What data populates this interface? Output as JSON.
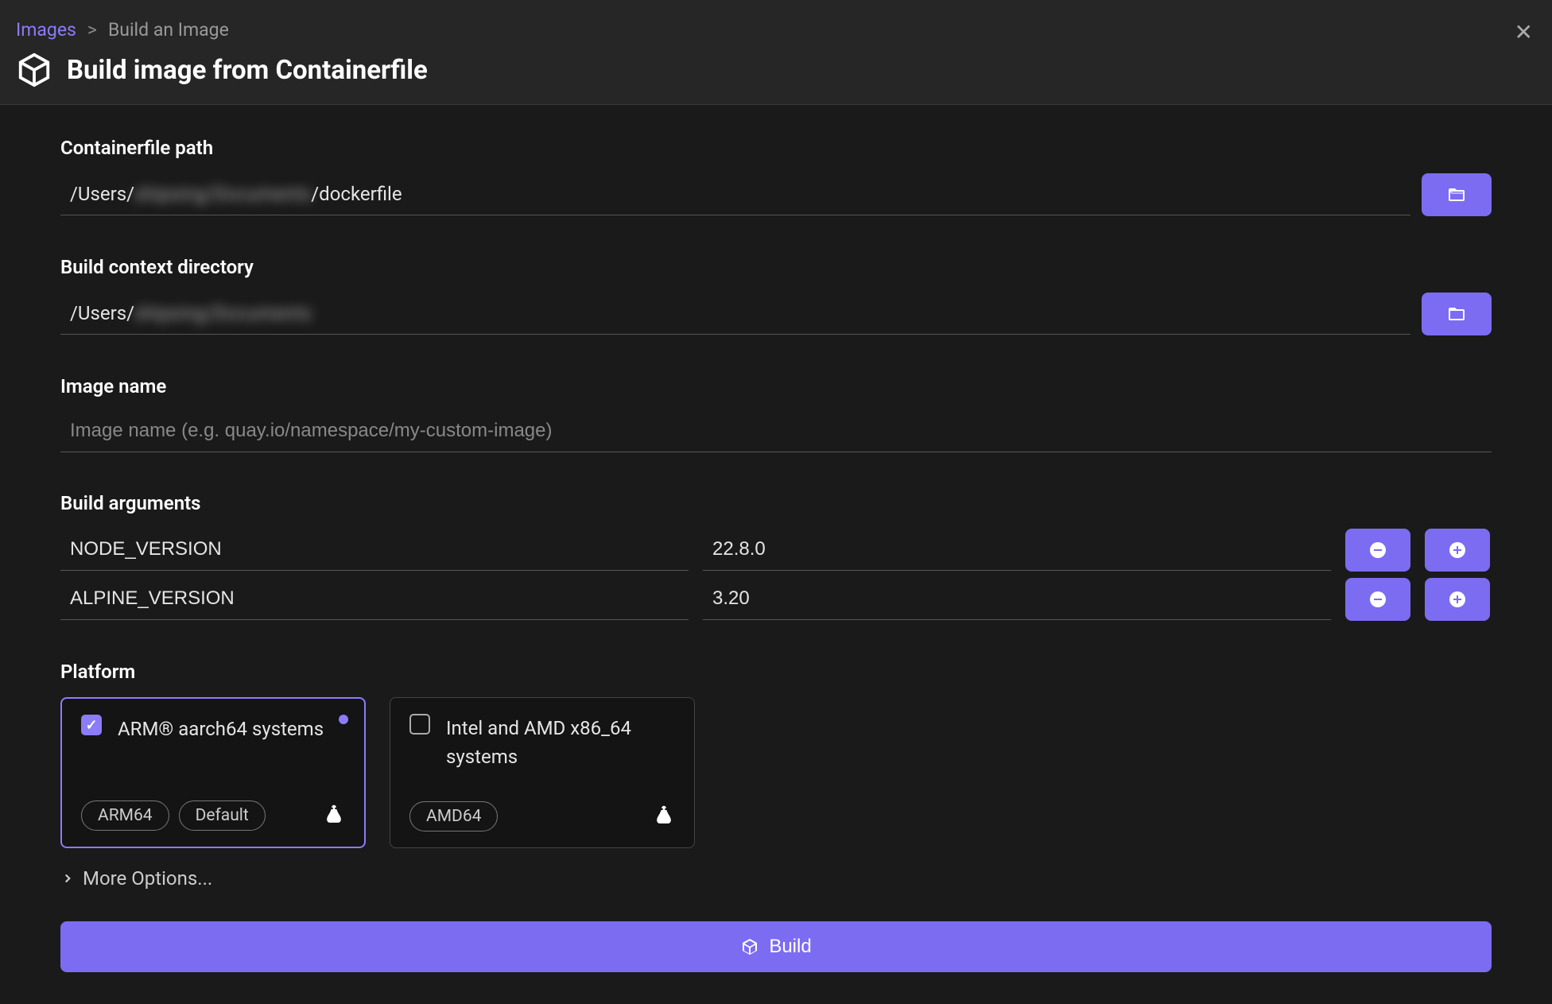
{
  "breadcrumb": {
    "root": "Images",
    "sep": ">",
    "current": "Build an Image"
  },
  "title": "Build image from Containerfile",
  "fields": {
    "containerfile": {
      "label": "Containerfile path",
      "value_prefix": "/Users/",
      "value_redacted": "shipsing/Documents",
      "value_suffix": "/dockerfile"
    },
    "context": {
      "label": "Build context directory",
      "value_prefix": "/Users/",
      "value_redacted": "shipsing/Documents",
      "value_suffix": ""
    },
    "image_name": {
      "label": "Image name",
      "placeholder": "Image name (e.g. quay.io/namespace/my-custom-image)"
    }
  },
  "build_args": {
    "label": "Build arguments",
    "rows": [
      {
        "key": "NODE_VERSION",
        "value": "22.8.0"
      },
      {
        "key": "ALPINE_VERSION",
        "value": "3.20"
      }
    ]
  },
  "platform": {
    "label": "Platform",
    "cards": [
      {
        "title": "ARM® aarch64 systems",
        "chips": [
          "ARM64",
          "Default"
        ],
        "checked": true
      },
      {
        "title": "Intel and AMD x86_64 systems",
        "chips": [
          "AMD64"
        ],
        "checked": false
      }
    ]
  },
  "more_options": "More Options...",
  "build_button": "Build"
}
